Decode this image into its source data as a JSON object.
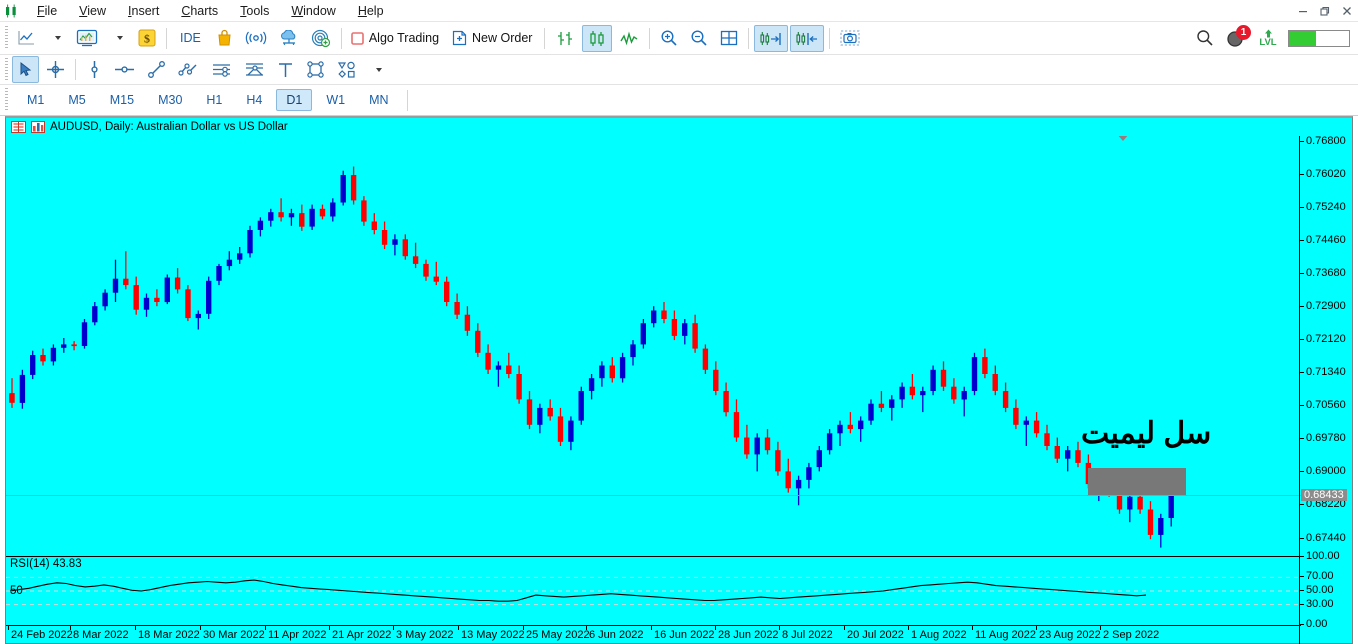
{
  "window": {
    "app_logo": "metatrader-logo",
    "controls": {
      "minimize": "–",
      "restore": "❐",
      "close": "✕"
    }
  },
  "menu": {
    "items": [
      {
        "name": "file",
        "label": "File",
        "accel": "F"
      },
      {
        "name": "view",
        "label": "View",
        "accel": "V"
      },
      {
        "name": "insert",
        "label": "Insert",
        "accel": "I"
      },
      {
        "name": "charts",
        "label": "Charts",
        "accel": "C"
      },
      {
        "name": "tools",
        "label": "Tools",
        "accel": "T"
      },
      {
        "name": "window",
        "label": "Window",
        "accel": "W"
      },
      {
        "name": "help",
        "label": "Help",
        "accel": "H"
      }
    ]
  },
  "toolbar": {
    "new_chart_icon": "line-chart-icon",
    "profiles_icon": "chart-window-icon",
    "market_watch_icon": "dollar-icon",
    "ide_label": "IDE",
    "market_icon": "shopping-bag-icon",
    "signals_icon": "broadcast-icon",
    "vps_icon": "cloud-icon",
    "community_icon": "radar-add-icon",
    "algo_trading_label": "Algo Trading",
    "new_order_label": "New Order",
    "bar_chart_icon": "bar-chart-icon",
    "candle_chart_icon": "candlestick-chart-icon",
    "line_chart_icon": "line-graph-icon",
    "zoom_in_icon": "zoom-in-icon",
    "zoom_out_icon": "zoom-out-icon",
    "grid_icon": "grid-icon",
    "scroll_end_icon": "scroll-to-end-icon",
    "chart_shift_icon": "chart-shift-icon",
    "screenshot_icon": "camera-icon",
    "search_icon": "search-icon",
    "notifications_icon": "notification-icon",
    "notifications_badge": "1",
    "level_label": "LVL",
    "level_icon": "level-up-icon",
    "progress_percent": 45,
    "progress_color": "#33cc33"
  },
  "drawbar": {
    "cursor_icon": "cursor-arrow-icon",
    "crosshair_icon": "crosshair-icon",
    "vertical_line_icon": "vertical-line-icon",
    "horizontal_line_icon": "horizontal-line-icon",
    "trendline_icon": "trendline-icon",
    "trendline_by_angle_icon": "trendline-by-angle-icon",
    "equidistant_channel_icon": "equidistant-channel-icon",
    "fibonacci_icon": "fibonacci-fan-icon",
    "text_icon": "text-tool-icon",
    "rectangle_icon": "rectangle-shape-icon",
    "shapes_icon": "shapes-icon"
  },
  "timeframes": {
    "items": [
      "M1",
      "M5",
      "M15",
      "M30",
      "H1",
      "H4",
      "D1",
      "W1",
      "MN"
    ],
    "active": "D1"
  },
  "chart": {
    "title": "AUDUSD, Daily:  Australian Dollar vs US Dollar",
    "symbol": "AUDUSD",
    "period": "Daily",
    "description": "Australian Dollar vs US Dollar",
    "properties_icon": "chart-properties-icon",
    "indicators_icon": "chart-indicators-icon",
    "background_color": "#00ffff",
    "bull_color": "#0000cc",
    "bear_color": "#ff0000",
    "current_price": "0.68433",
    "annotation": "سل لیمیت",
    "sell_zone_color": "#787878"
  },
  "chart_data": {
    "type": "line",
    "title": "AUDUSD, Daily:  Australian Dollar vs US Dollar",
    "xlabel": "",
    "ylabel": "",
    "ylim": [
      0.6705,
      0.7692
    ],
    "grid": false,
    "legend": "none",
    "price_ticks": [
      "0.76800",
      "0.76020",
      "0.75240",
      "0.74460",
      "0.73680",
      "0.72900",
      "0.72120",
      "0.71340",
      "0.70560",
      "0.69780",
      "0.69000",
      "0.68220",
      "0.67440"
    ],
    "price_tick_values": [
      0.768,
      0.7602,
      0.7524,
      0.7446,
      0.7368,
      0.729,
      0.7212,
      0.7134,
      0.7056,
      0.6978,
      0.69,
      0.6822,
      0.6744
    ],
    "date_ticks": [
      "24 Feb 2022",
      "8 Mar 2022",
      "18 Mar 2022",
      "30 Mar 2022",
      "11 Apr 2022",
      "21 Apr 2022",
      "3 May 2022",
      "13 May 2022",
      "25 May 2022",
      "6 Jun 2022",
      "16 Jun 2022",
      "28 Jun 2022",
      "8 Jul 2022",
      "20 Jul 2022",
      "1 Aug 2022",
      "11 Aug 2022",
      "23 Aug 2022",
      "2 Sep 2022"
    ],
    "date_tick_x": [
      2,
      64,
      129,
      194,
      259,
      323,
      387,
      452,
      517,
      580,
      645,
      709,
      773,
      838,
      902,
      966,
      1030,
      1094
    ],
    "current_price": 0.68433,
    "sell_limit_zone": {
      "price_top": 0.6908,
      "price_bottom": 0.68433,
      "x_start": 1082,
      "x_end": 1180
    },
    "annotation_text": "سل لیمیت",
    "candles": [
      [
        0.7085,
        0.712,
        0.705,
        0.7062
      ],
      [
        0.7062,
        0.714,
        0.7048,
        0.7128
      ],
      [
        0.7128,
        0.7185,
        0.7118,
        0.7175
      ],
      [
        0.7175,
        0.719,
        0.715,
        0.716
      ],
      [
        0.716,
        0.72,
        0.715,
        0.7192
      ],
      [
        0.7192,
        0.7215,
        0.718,
        0.72
      ],
      [
        0.72,
        0.7208,
        0.7186,
        0.7196
      ],
      [
        0.7196,
        0.726,
        0.719,
        0.7252
      ],
      [
        0.7252,
        0.73,
        0.7245,
        0.729
      ],
      [
        0.729,
        0.733,
        0.728,
        0.7322
      ],
      [
        0.7322,
        0.74,
        0.73,
        0.7355
      ],
      [
        0.7355,
        0.742,
        0.733,
        0.734
      ],
      [
        0.734,
        0.736,
        0.727,
        0.7282
      ],
      [
        0.7282,
        0.732,
        0.7265,
        0.731
      ],
      [
        0.731,
        0.733,
        0.729,
        0.73
      ],
      [
        0.73,
        0.7365,
        0.7295,
        0.7358
      ],
      [
        0.7358,
        0.738,
        0.732,
        0.733
      ],
      [
        0.733,
        0.734,
        0.7255,
        0.7262
      ],
      [
        0.7262,
        0.728,
        0.7235,
        0.7272
      ],
      [
        0.7272,
        0.736,
        0.726,
        0.735
      ],
      [
        0.735,
        0.739,
        0.734,
        0.7385
      ],
      [
        0.7385,
        0.742,
        0.7375,
        0.74
      ],
      [
        0.74,
        0.743,
        0.739,
        0.7415
      ],
      [
        0.7415,
        0.748,
        0.7405,
        0.747
      ],
      [
        0.747,
        0.75,
        0.7455,
        0.7492
      ],
      [
        0.7492,
        0.752,
        0.7478,
        0.7512
      ],
      [
        0.7512,
        0.7545,
        0.749,
        0.75
      ],
      [
        0.75,
        0.752,
        0.748,
        0.751
      ],
      [
        0.751,
        0.753,
        0.7468,
        0.7478
      ],
      [
        0.7478,
        0.753,
        0.747,
        0.752
      ],
      [
        0.752,
        0.753,
        0.7495,
        0.7502
      ],
      [
        0.7502,
        0.7545,
        0.749,
        0.7535
      ],
      [
        0.7535,
        0.761,
        0.7528,
        0.76
      ],
      [
        0.76,
        0.762,
        0.753,
        0.754
      ],
      [
        0.754,
        0.755,
        0.748,
        0.749
      ],
      [
        0.749,
        0.751,
        0.746,
        0.747
      ],
      [
        0.747,
        0.749,
        0.7425,
        0.7435
      ],
      [
        0.7435,
        0.746,
        0.741,
        0.7448
      ],
      [
        0.7448,
        0.746,
        0.74,
        0.7408
      ],
      [
        0.7408,
        0.744,
        0.738,
        0.739
      ],
      [
        0.739,
        0.74,
        0.735,
        0.736
      ],
      [
        0.736,
        0.7395,
        0.734,
        0.7348
      ],
      [
        0.7348,
        0.736,
        0.729,
        0.73
      ],
      [
        0.73,
        0.732,
        0.726,
        0.727
      ],
      [
        0.727,
        0.729,
        0.722,
        0.7232
      ],
      [
        0.7232,
        0.725,
        0.717,
        0.718
      ],
      [
        0.718,
        0.72,
        0.713,
        0.714
      ],
      [
        0.714,
        0.716,
        0.71,
        0.715
      ],
      [
        0.715,
        0.718,
        0.712,
        0.713
      ],
      [
        0.713,
        0.715,
        0.706,
        0.707
      ],
      [
        0.707,
        0.709,
        0.7,
        0.701
      ],
      [
        0.701,
        0.706,
        0.699,
        0.705
      ],
      [
        0.705,
        0.707,
        0.702,
        0.703
      ],
      [
        0.703,
        0.705,
        0.696,
        0.697
      ],
      [
        0.697,
        0.703,
        0.695,
        0.702
      ],
      [
        0.702,
        0.71,
        0.701,
        0.709
      ],
      [
        0.709,
        0.713,
        0.707,
        0.712
      ],
      [
        0.712,
        0.716,
        0.71,
        0.715
      ],
      [
        0.715,
        0.717,
        0.711,
        0.712
      ],
      [
        0.712,
        0.718,
        0.711,
        0.717
      ],
      [
        0.717,
        0.721,
        0.715,
        0.72
      ],
      [
        0.72,
        0.726,
        0.719,
        0.725
      ],
      [
        0.725,
        0.729,
        0.724,
        0.728
      ],
      [
        0.728,
        0.73,
        0.725,
        0.726
      ],
      [
        0.726,
        0.728,
        0.721,
        0.722
      ],
      [
        0.722,
        0.726,
        0.72,
        0.725
      ],
      [
        0.725,
        0.727,
        0.718,
        0.719
      ],
      [
        0.719,
        0.72,
        0.713,
        0.714
      ],
      [
        0.714,
        0.716,
        0.708,
        0.709
      ],
      [
        0.709,
        0.711,
        0.703,
        0.704
      ],
      [
        0.704,
        0.707,
        0.697,
        0.698
      ],
      [
        0.698,
        0.701,
        0.693,
        0.694
      ],
      [
        0.694,
        0.699,
        0.69,
        0.698
      ],
      [
        0.698,
        0.7,
        0.694,
        0.695
      ],
      [
        0.695,
        0.697,
        0.689,
        0.69
      ],
      [
        0.69,
        0.693,
        0.685,
        0.686
      ],
      [
        0.686,
        0.689,
        0.682,
        0.688
      ],
      [
        0.688,
        0.692,
        0.686,
        0.691
      ],
      [
        0.691,
        0.696,
        0.69,
        0.695
      ],
      [
        0.695,
        0.7,
        0.694,
        0.699
      ],
      [
        0.699,
        0.702,
        0.696,
        0.701
      ],
      [
        0.701,
        0.704,
        0.699,
        0.7
      ],
      [
        0.7,
        0.703,
        0.697,
        0.702
      ],
      [
        0.702,
        0.707,
        0.701,
        0.706
      ],
      [
        0.706,
        0.709,
        0.704,
        0.705
      ],
      [
        0.705,
        0.708,
        0.702,
        0.707
      ],
      [
        0.707,
        0.711,
        0.705,
        0.71
      ],
      [
        0.71,
        0.713,
        0.707,
        0.708
      ],
      [
        0.708,
        0.71,
        0.704,
        0.709
      ],
      [
        0.709,
        0.715,
        0.708,
        0.714
      ],
      [
        0.714,
        0.716,
        0.709,
        0.71
      ],
      [
        0.71,
        0.712,
        0.706,
        0.707
      ],
      [
        0.707,
        0.71,
        0.703,
        0.709
      ],
      [
        0.709,
        0.718,
        0.708,
        0.717
      ],
      [
        0.717,
        0.719,
        0.712,
        0.713
      ],
      [
        0.713,
        0.715,
        0.708,
        0.709
      ],
      [
        0.709,
        0.711,
        0.704,
        0.705
      ],
      [
        0.705,
        0.707,
        0.7,
        0.701
      ],
      [
        0.701,
        0.703,
        0.696,
        0.702
      ],
      [
        0.702,
        0.704,
        0.698,
        0.699
      ],
      [
        0.699,
        0.701,
        0.695,
        0.696
      ],
      [
        0.696,
        0.698,
        0.692,
        0.693
      ],
      [
        0.693,
        0.696,
        0.69,
        0.695
      ],
      [
        0.695,
        0.697,
        0.691,
        0.692
      ],
      [
        0.692,
        0.694,
        0.686,
        0.687
      ],
      [
        0.687,
        0.689,
        0.683,
        0.688
      ],
      [
        0.688,
        0.69,
        0.684,
        0.685
      ],
      [
        0.685,
        0.687,
        0.68,
        0.681
      ],
      [
        0.681,
        0.685,
        0.678,
        0.684
      ],
      [
        0.684,
        0.688,
        0.68,
        0.681
      ],
      [
        0.681,
        0.683,
        0.674,
        0.675
      ],
      [
        0.675,
        0.68,
        0.672,
        0.679
      ],
      [
        0.679,
        0.685,
        0.677,
        0.6843
      ]
    ]
  },
  "rsi": {
    "label": "RSI(14) 43.83",
    "period": 14,
    "value": 43.83,
    "level_label": "50",
    "ticks": [
      "100.00",
      "70.00",
      "50.00",
      "30.00",
      "0.00"
    ],
    "tick_values": [
      100,
      70,
      50,
      30,
      0
    ],
    "dashed_levels": [
      70,
      50,
      30
    ],
    "values": [
      50,
      52,
      54,
      57,
      60,
      62,
      61,
      58,
      56,
      57,
      59,
      57,
      54,
      51,
      50,
      52,
      55,
      58,
      60,
      62,
      63,
      64,
      63,
      62,
      63,
      65,
      66,
      64,
      61,
      59,
      57,
      55,
      54,
      53,
      52,
      51,
      50,
      49,
      48,
      47,
      46,
      45,
      44,
      43,
      42,
      41,
      40,
      39,
      38,
      37,
      36,
      36,
      35,
      35,
      36,
      40,
      44,
      43,
      42,
      41,
      42,
      43,
      44,
      45,
      46,
      45,
      44,
      43,
      42,
      41,
      40,
      39,
      38,
      37,
      36,
      36,
      37,
      38,
      39,
      40,
      41,
      40,
      39,
      40,
      41,
      42,
      43,
      44,
      45,
      46,
      47,
      48,
      49,
      50,
      52,
      54,
      56,
      58,
      59,
      60,
      61,
      62,
      63,
      62,
      60,
      58,
      57,
      56,
      55,
      54,
      53,
      52,
      51,
      50,
      49,
      48,
      47,
      46,
      45,
      44,
      43,
      44
    ]
  }
}
